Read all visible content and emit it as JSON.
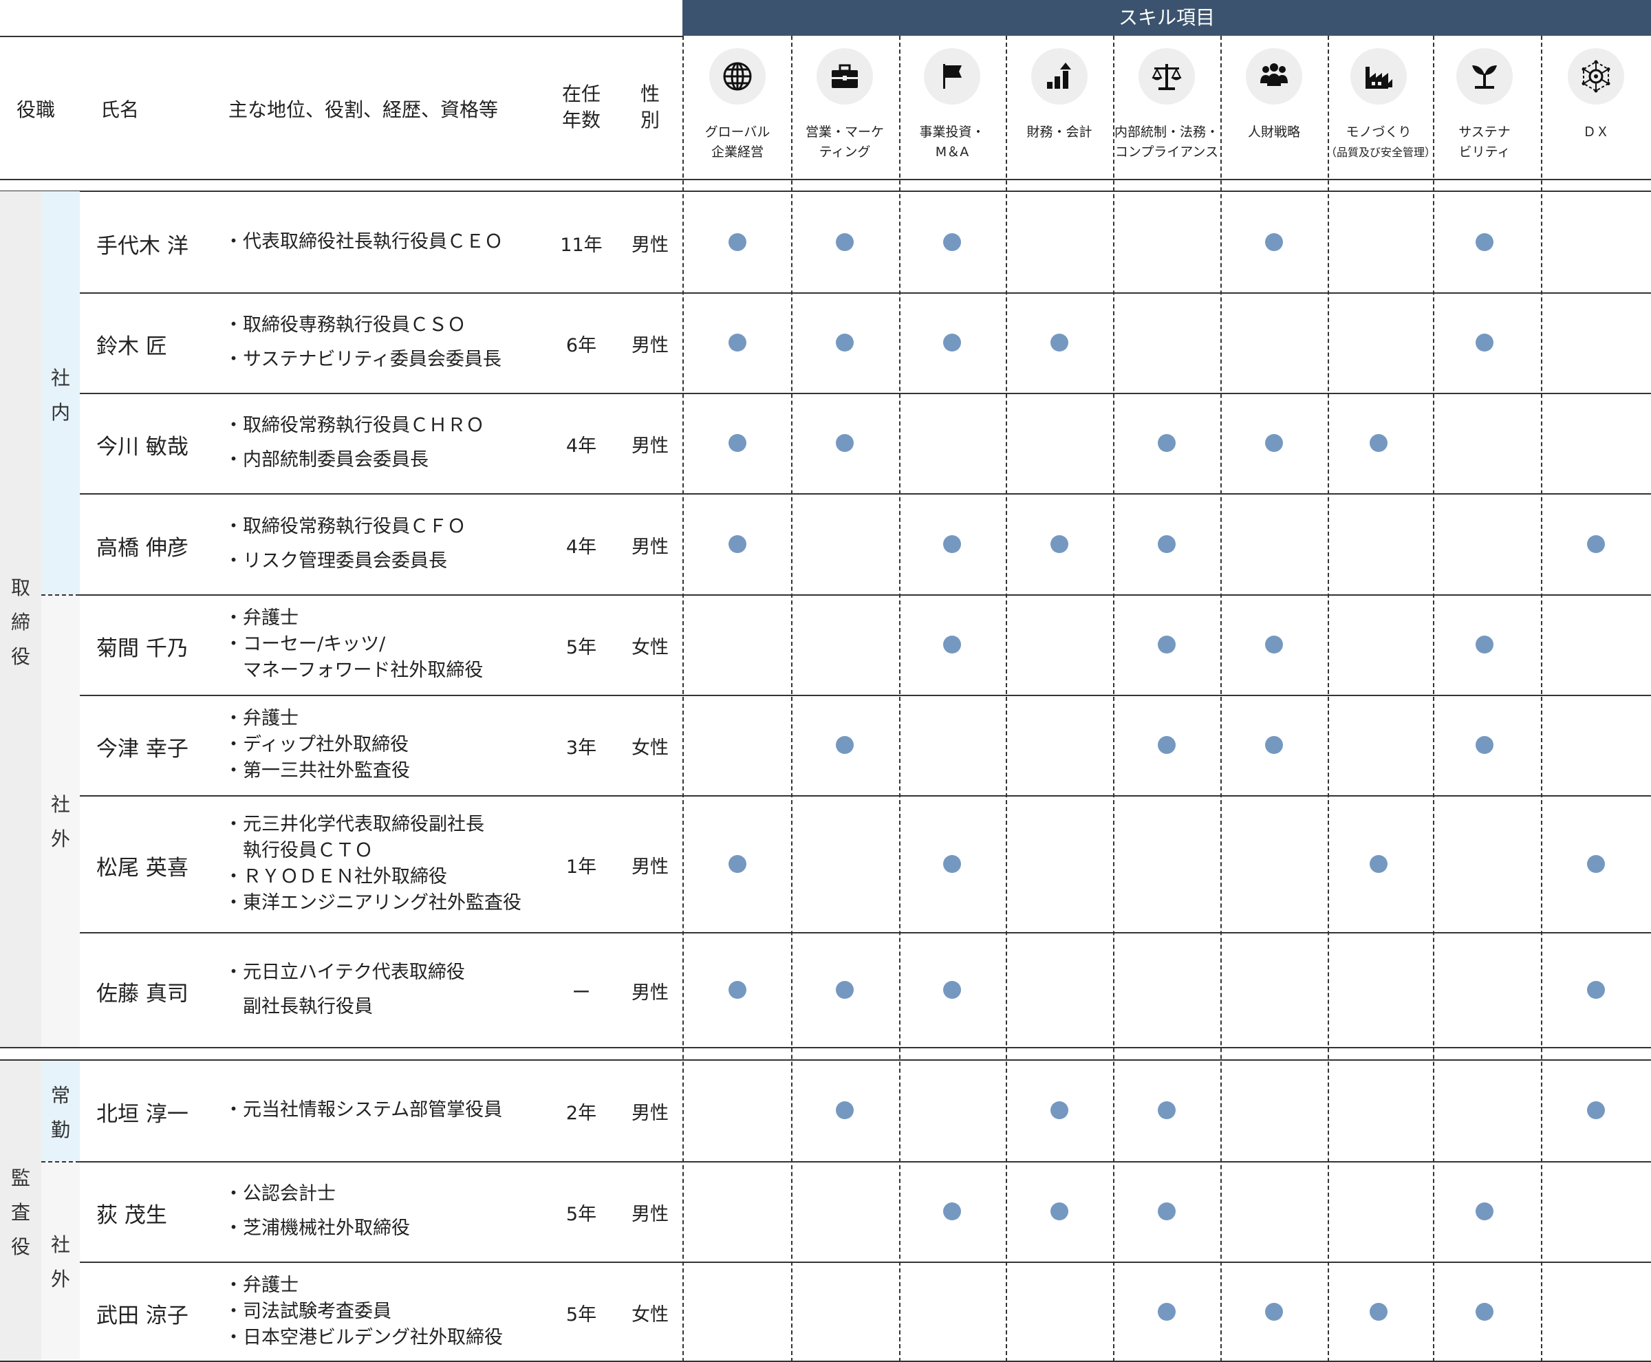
{
  "headers": {
    "skill_banner": "スキル項目",
    "position": "役職",
    "name": "氏名",
    "roles": "主な地位、役割、経歴、資格等",
    "tenure_line1": "在任",
    "tenure_line2": "年数",
    "gender_line1": "性",
    "gender_line2": "別"
  },
  "skills": [
    {
      "line1": "グローバル",
      "line2": "企業経営",
      "icon": "globe-icon"
    },
    {
      "line1": "営業・マーケ",
      "line2": "ティング",
      "icon": "briefcase-icon"
    },
    {
      "line1": "事業投資・",
      "line2": "M＆A",
      "icon": "flag-icon"
    },
    {
      "line1": "財務・会計",
      "line2": "",
      "icon": "bar-chart-icon"
    },
    {
      "line1": "内部統制・法務・",
      "line2": "コンプライアンス",
      "icon": "scales-icon"
    },
    {
      "line1": "人財戦略",
      "line2": "",
      "icon": "people-icon"
    },
    {
      "line1": "モノづくり",
      "line2": "（品質及び安全管理）",
      "icon": "factory-icon"
    },
    {
      "line1": "サステナ",
      "line2": "ビリティ",
      "icon": "sprout-icon"
    },
    {
      "line1": "ＤＸ",
      "line2": "",
      "icon": "network-icon"
    }
  ],
  "groups": {
    "director": [
      "取",
      "締",
      "役"
    ],
    "auditor": [
      "監",
      "査",
      "役"
    ],
    "internal": [
      "社",
      "内"
    ],
    "external": [
      "社",
      "外"
    ],
    "fulltime": [
      "常",
      "勤"
    ],
    "auditor_external": [
      "社",
      "外"
    ]
  },
  "members": [
    {
      "name": "手代木 洋",
      "roles": [
        "・代表取締役社長執行役員ＣＥＯ"
      ],
      "tenure": "11年",
      "gender": "男性",
      "skills": [
        1,
        1,
        1,
        0,
        0,
        1,
        0,
        1,
        0
      ]
    },
    {
      "name": "鈴木 匠",
      "roles": [
        "・取締役専務執行役員ＣＳＯ",
        "・サステナビリティ委員会委員長"
      ],
      "tenure": "6年",
      "gender": "男性",
      "skills": [
        1,
        1,
        1,
        1,
        0,
        0,
        0,
        1,
        0
      ]
    },
    {
      "name": "今川 敏哉",
      "roles": [
        "・取締役常務執行役員ＣＨＲＯ",
        "・内部統制委員会委員長"
      ],
      "tenure": "4年",
      "gender": "男性",
      "skills": [
        1,
        1,
        0,
        0,
        1,
        1,
        1,
        0,
        0
      ]
    },
    {
      "name": "高橋 伸彦",
      "roles": [
        "・取締役常務執行役員ＣＦＯ",
        "・リスク管理委員会委員長"
      ],
      "tenure": "4年",
      "gender": "男性",
      "skills": [
        1,
        0,
        1,
        1,
        1,
        0,
        0,
        0,
        1
      ]
    },
    {
      "name": "菊間 千乃",
      "roles": [
        "・弁護士",
        "・コーセー/キッツ/",
        "　マネーフォワード社外取締役"
      ],
      "tenure": "5年",
      "gender": "女性",
      "skills": [
        0,
        0,
        1,
        0,
        1,
        1,
        0,
        1,
        0
      ]
    },
    {
      "name": "今津 幸子",
      "roles": [
        "・弁護士",
        "・ディップ社外取締役",
        "・第一三共社外監査役"
      ],
      "tenure": "3年",
      "gender": "女性",
      "skills": [
        0,
        1,
        0,
        0,
        1,
        1,
        0,
        1,
        0
      ]
    },
    {
      "name": "松尾 英喜",
      "roles": [
        "・元三井化学代表取締役副社長",
        "　執行役員ＣＴＯ",
        "・ＲＹＯＤＥＮ社外取締役",
        "・東洋エンジニアリング社外監査役"
      ],
      "tenure": "1年",
      "gender": "男性",
      "skills": [
        1,
        0,
        1,
        0,
        0,
        0,
        1,
        0,
        1
      ]
    },
    {
      "name": "佐藤 真司",
      "roles": [
        "・元日立ハイテク代表取締役",
        "　副社長執行役員"
      ],
      "tenure": "ー",
      "gender": "男性",
      "skills": [
        1,
        1,
        1,
        0,
        0,
        0,
        0,
        0,
        1
      ]
    },
    {
      "name": "北垣 淳一",
      "roles": [
        "・元当社情報システム部管掌役員"
      ],
      "tenure": "2年",
      "gender": "男性",
      "skills": [
        0,
        1,
        0,
        1,
        1,
        0,
        0,
        0,
        1
      ]
    },
    {
      "name": "荻 茂生",
      "roles": [
        "・公認会計士",
        "・芝浦機械社外取締役"
      ],
      "tenure": "5年",
      "gender": "男性",
      "skills": [
        0,
        0,
        1,
        1,
        1,
        0,
        0,
        1,
        0
      ]
    },
    {
      "name": "武田 涼子",
      "roles": [
        "・弁護士",
        "・司法試験考査委員",
        "・日本空港ビルデング社外取締役"
      ],
      "tenure": "5年",
      "gender": "女性",
      "skills": [
        0,
        0,
        0,
        0,
        1,
        1,
        1,
        1,
        0
      ]
    }
  ],
  "colors": {
    "banner": "#3b536e",
    "dot": "#7598c0",
    "director_band": "#eeeeee",
    "internal_band": "#e6f3fb",
    "external_band": "#f6f6f6"
  }
}
